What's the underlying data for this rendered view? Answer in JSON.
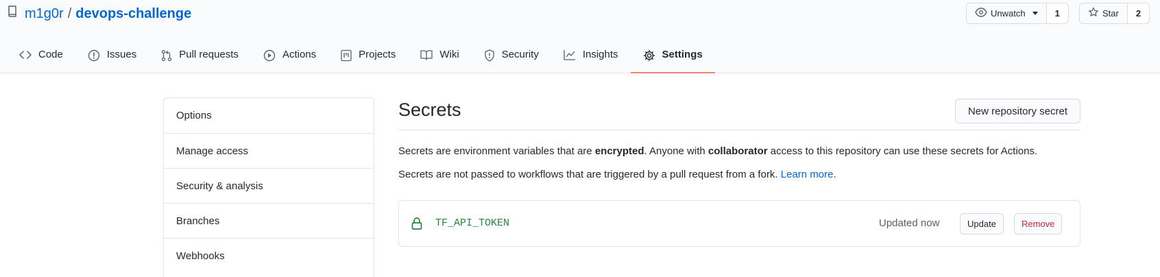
{
  "repo": {
    "owner": "m1g0r",
    "separator": "/",
    "name": "devops-challenge"
  },
  "watch": {
    "label": "Unwatch",
    "count": "1"
  },
  "star": {
    "label": "Star",
    "count": "2"
  },
  "tabs": [
    {
      "label": "Code",
      "icon": "code-icon"
    },
    {
      "label": "Issues",
      "icon": "issue-icon"
    },
    {
      "label": "Pull requests",
      "icon": "pull-request-icon"
    },
    {
      "label": "Actions",
      "icon": "play-icon"
    },
    {
      "label": "Projects",
      "icon": "project-icon"
    },
    {
      "label": "Wiki",
      "icon": "book-icon"
    },
    {
      "label": "Security",
      "icon": "shield-icon"
    },
    {
      "label": "Insights",
      "icon": "graph-icon"
    },
    {
      "label": "Settings",
      "icon": "gear-icon",
      "active": true
    }
  ],
  "sidebar": {
    "items": [
      {
        "label": "Options"
      },
      {
        "label": "Manage access"
      },
      {
        "label": "Security & analysis"
      },
      {
        "label": "Branches"
      },
      {
        "label": "Webhooks"
      }
    ]
  },
  "main": {
    "title": "Secrets",
    "new_button": "New repository secret",
    "desc1": {
      "a": "Secrets are environment variables that are ",
      "b": "encrypted",
      "c": ". Anyone with ",
      "d": "collaborator",
      "e": " access to this repository can use these secrets for Actions."
    },
    "desc2": {
      "a": "Secrets are not passed to workflows that are triggered by a pull request from a fork. ",
      "link": "Learn more",
      "end": "."
    }
  },
  "secret": {
    "name": "TF_API_TOKEN",
    "updated": "Updated now",
    "update_label": "Update",
    "remove_label": "Remove"
  },
  "colors": {
    "accent": "#f9826c",
    "link": "#0366d6",
    "secret_green": "#22863a",
    "danger": "#cb2431"
  }
}
